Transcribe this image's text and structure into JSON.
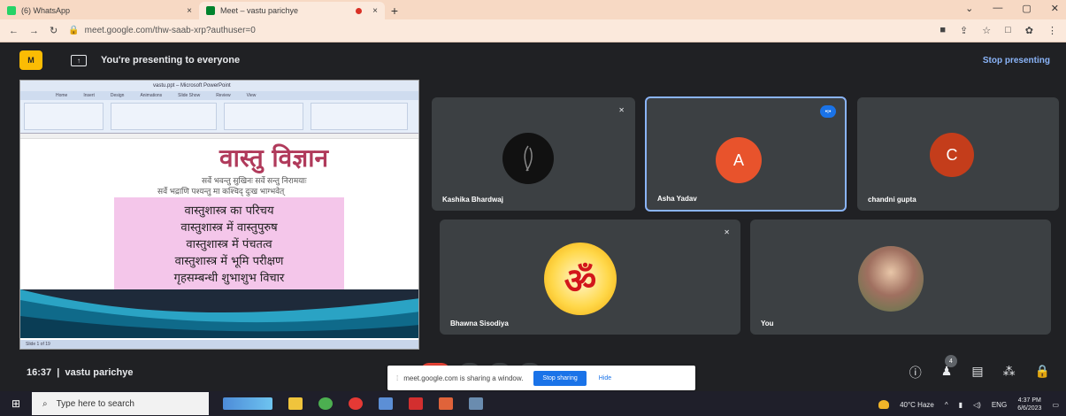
{
  "browser": {
    "tabs": [
      {
        "title": "(6) WhatsApp",
        "color": "#25d366"
      },
      {
        "title": "Meet – vastu parichye",
        "color": "#00832d"
      }
    ],
    "new_tab": "+",
    "url": "meet.google.com/thw-saab-xrp?authuser=0"
  },
  "meet": {
    "presenting_text": "You're presenting to everyone",
    "stop_presenting": "Stop presenting",
    "meeting_time": "16:37",
    "meeting_name": "vastu parichye",
    "share_notice": "meet.google.com is sharing a window.",
    "stop_sharing": "Stop sharing",
    "hide": "Hide",
    "people_count": "4"
  },
  "slide": {
    "window_title": "vastu.ppt – Microsoft PowerPoint",
    "ribbon_tabs": [
      "Home",
      "Insert",
      "Design",
      "Animations",
      "Slide Show",
      "Review",
      "View"
    ],
    "title": "वास्तु विज्ञान",
    "mantra_line1": "सर्वे भवन्तु सुखिनः सर्वे सन्तु निरामयाः",
    "mantra_line2": "सर्वे भद्राणि पश्यन्तु मा कश्चिद् दुःख भाग्भवेत्",
    "lines": [
      "वास्तुशास्त्र का परिचय",
      "वास्तुशास्त्र में वास्तुपुरुष",
      "वास्तुशास्त्र में पंचतत्व",
      "वास्तुशास्त्र में भूमि परीक्षण",
      "गृहसम्बन्धी शुभाशुभ विचार"
    ],
    "status_text": "Slide 1 of 19"
  },
  "participants": [
    {
      "name": "Kashika Bhardwaj"
    },
    {
      "name": "Asha Yadav",
      "initial": "A",
      "color": "#e8532c"
    },
    {
      "name": "chandni gupta",
      "initial": "C",
      "color": "#c43d1b"
    },
    {
      "name": "Bhawna Sisodiya"
    },
    {
      "name": "You"
    }
  ],
  "taskbar": {
    "search_placeholder": "Type here to search",
    "weather": "40°C Haze",
    "lang": "ENG",
    "time": "4:37 PM",
    "date": "6/6/2023"
  }
}
